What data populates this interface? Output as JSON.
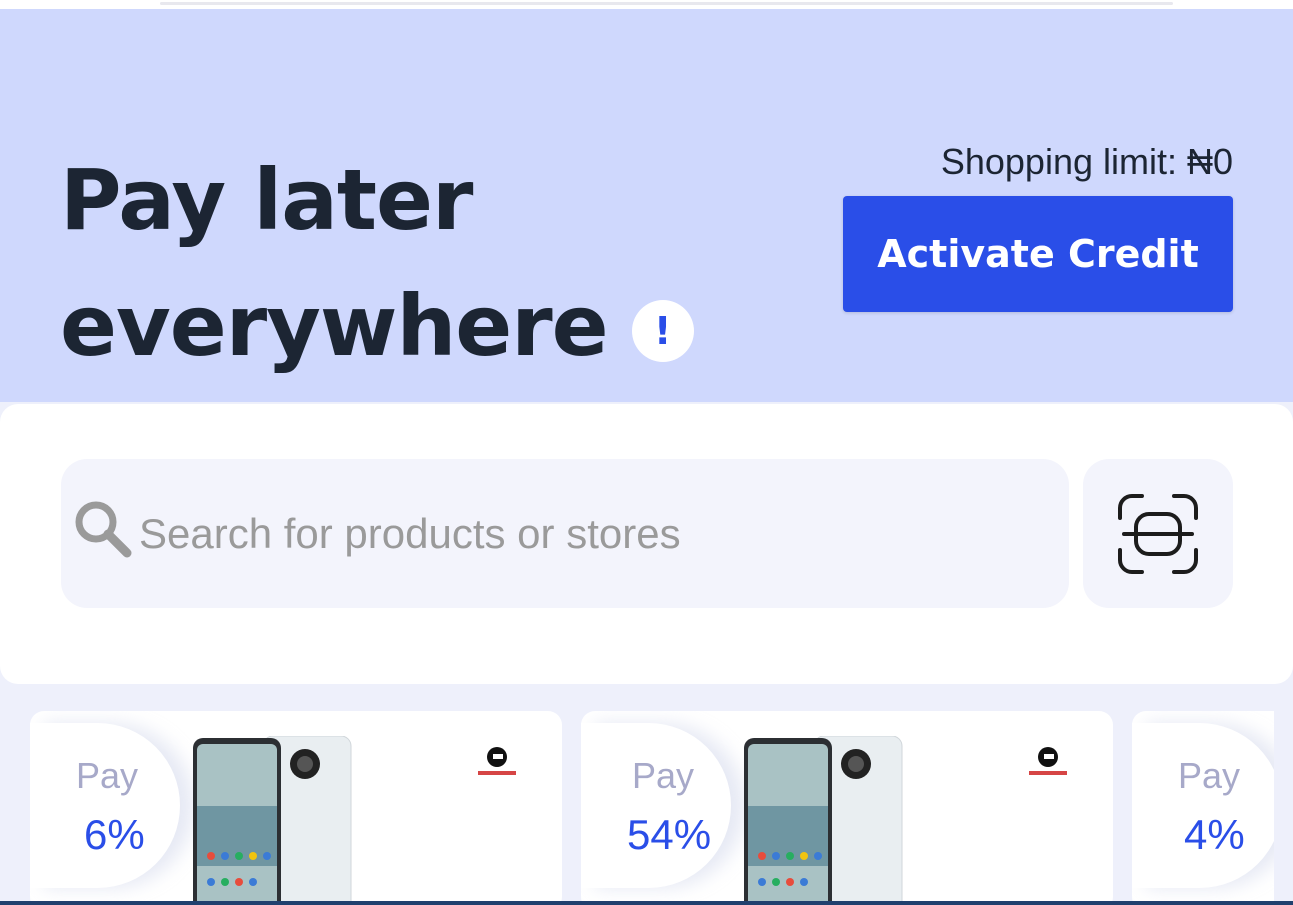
{
  "hero": {
    "title_line1": "Pay later",
    "title_line2": "everywhere",
    "info_glyph": "!",
    "shopping_limit": "Shopping limit: ₦0",
    "activate_button": "Activate Credit",
    "background_color": "#cfd8fd",
    "accent_color": "#2a4ee8"
  },
  "search": {
    "placeholder": "Search for products or stores",
    "icon": "search-icon",
    "scan_icon": "scan-icon"
  },
  "deals": [
    {
      "pay_label": "Pay",
      "percent": "6%",
      "store_logo_icon": "store-logo-icon"
    },
    {
      "pay_label": "Pay",
      "percent": "54%",
      "store_logo_icon": "store-logo-icon"
    },
    {
      "pay_label": "Pay",
      "percent": "4%",
      "store_logo_icon": "store-logo-icon"
    }
  ]
}
